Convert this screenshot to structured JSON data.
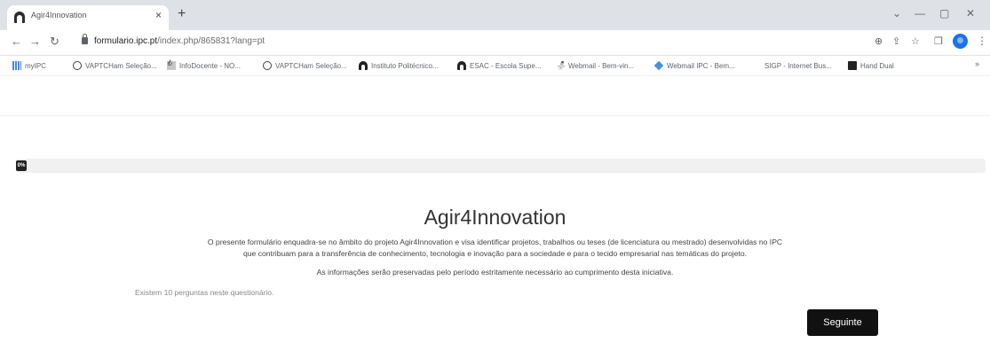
{
  "browser": {
    "tab": {
      "title": "Agir4Innovation",
      "close_glyph": "×"
    },
    "new_tab_glyph": "+",
    "window_controls": [
      "⌄",
      "—",
      "▢",
      "✕"
    ],
    "nav": {
      "back": "←",
      "forward": "→",
      "reload": "↻"
    },
    "url": {
      "host": "formulario.ipc.pt",
      "path": "/index.php/865831?lang=pt"
    },
    "toolbar_icons": [
      "⊕",
      "⇪",
      "☆",
      "❐"
    ],
    "menu_glyph": "⋮",
    "bookmarks": [
      {
        "label": "myIPC",
        "icon": "grid-icon"
      },
      {
        "label": "VAPTCHam Seleção...",
        "icon": "globe-icon"
      },
      {
        "label": "InfoDocente - NO...",
        "icon": "doc-icon"
      },
      {
        "label": "VAPTCHam Seleção...",
        "icon": "globe-icon"
      },
      {
        "label": "Instituto Politécnico...",
        "icon": "arch-icon"
      },
      {
        "label": "ESAC - Escola Supe...",
        "icon": "arch-icon"
      },
      {
        "label": "Webmail - Bem-vin...",
        "icon": "people-icon"
      },
      {
        "label": "Webmail IPC - Bem...",
        "icon": "diamond-icon"
      },
      {
        "label": "SIGP - Internet Bus...",
        "icon": "none"
      },
      {
        "label": "Hand Dual",
        "icon": "square-icon"
      }
    ],
    "bookmarks_more": "»"
  },
  "survey": {
    "progress_label": "0%",
    "progress_value": 0,
    "title": "Agir4Innovation",
    "description_line1": "O presente formulário enquadra-se no âmbito do projeto Agir4Innovation e visa identificar projetos, trabalhos ou teses (de licenciatura ou mestrado) desenvolvidas no IPC",
    "description_line2": "que contribuam para a transferência de conhecimento, tecnologia e inovação para a sociedade e para o tecido empresarial nas temáticas do projeto.",
    "privacy_note": "As informações serão preservadas pelo período estritamente necessário ao cumprimento desta iniciativa.",
    "question_count": "Existem 10 perguntas neste questionário.",
    "next_button": "Seguinte"
  }
}
